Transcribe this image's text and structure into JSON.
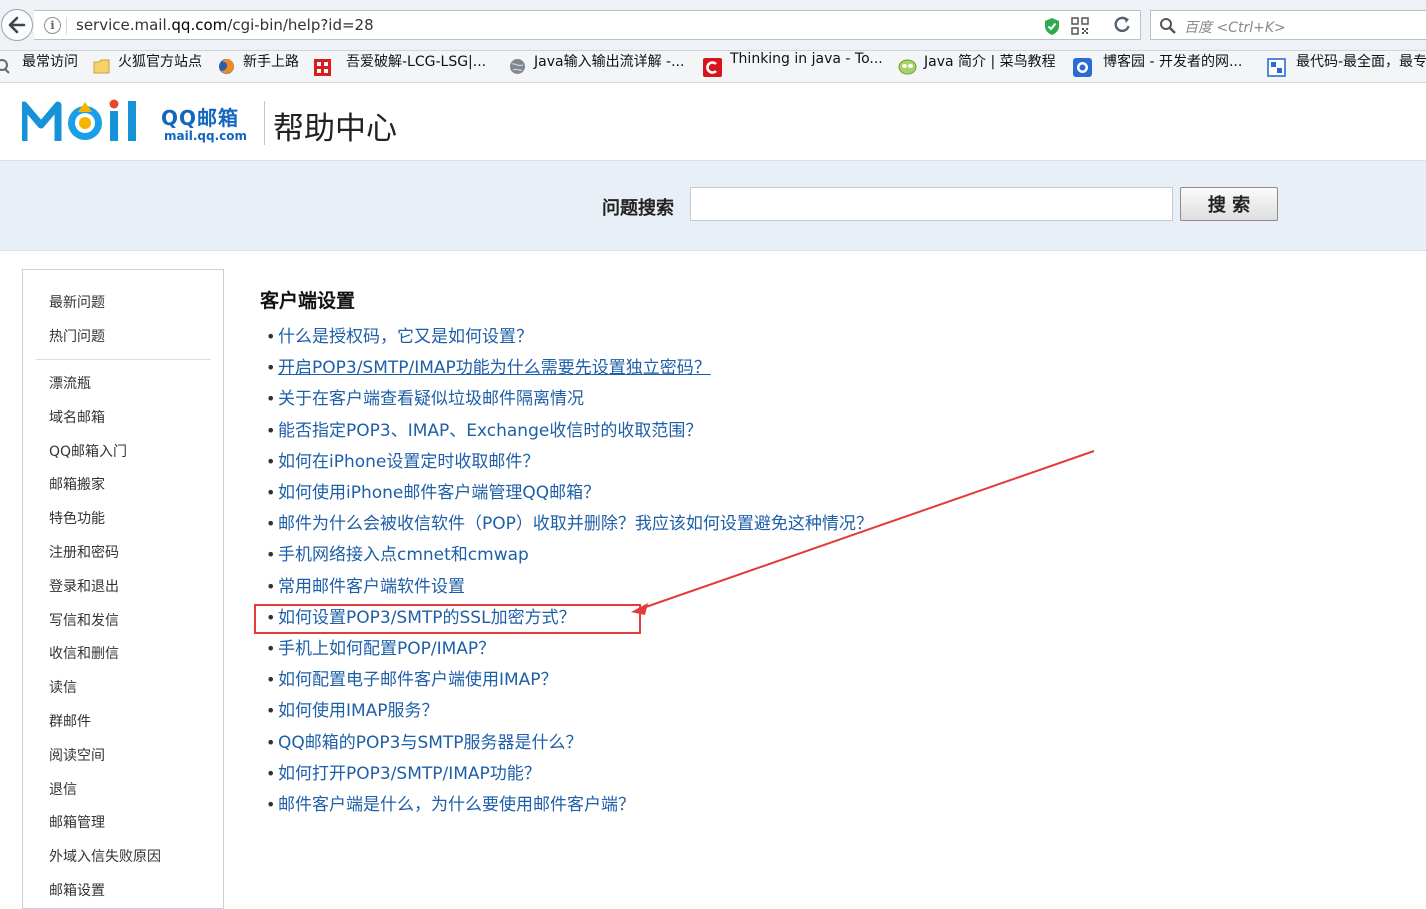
{
  "browser": {
    "url_prefix": "service.mail.",
    "url_host": "qq.com",
    "url_path": "/cgi-bin/help?id=28",
    "search_placeholder": "百度 <Ctrl+K>",
    "bookmarks": [
      {
        "label": "最常访问",
        "icon": "most-visited-icon"
      },
      {
        "label": "火狐官方站点",
        "icon": "folder-icon"
      },
      {
        "label": "新手上路",
        "icon": "firefox-icon"
      },
      {
        "label": "吾爱破解-LCG-LSG|...",
        "icon": "site-icon"
      },
      {
        "label": "Java输入输出流详解 -...",
        "icon": "globe-icon"
      },
      {
        "label": "Thinking in java - To...",
        "icon": "csdn-icon"
      },
      {
        "label": "Java 简介 | 菜鸟教程",
        "icon": "runoob-icon"
      },
      {
        "label": "博客园 - 开发者的网...",
        "icon": "cnblogs-icon"
      },
      {
        "label": "最代码-最全面，最专",
        "icon": "zuidaima-icon"
      }
    ]
  },
  "header": {
    "logo_text": "QQ邮箱",
    "logo_domain": "mail.qq.com",
    "title": "帮助中心"
  },
  "search": {
    "label": "问题搜索",
    "placeholder": "",
    "button": "搜 索"
  },
  "sidebar": {
    "top_items": [
      "最新问题",
      "热门问题"
    ],
    "items": [
      "漂流瓶",
      "域名邮箱",
      "QQ邮箱入门",
      "邮箱搬家",
      "特色功能",
      "注册和密码",
      "登录和退出",
      "写信和发信",
      "收信和删信",
      "读信",
      "群邮件",
      "阅读空间",
      "退信",
      "邮箱管理",
      "外域入信失败原因",
      "邮箱设置"
    ]
  },
  "main": {
    "section_title": "客户端设置",
    "bullet": "•",
    "questions": [
      "什么是授权码，它又是如何设置？",
      "开启POP3/SMTP/IMAP功能为什么需要先设置独立密码？",
      "关于在客户端查看疑似垃圾邮件隔离情况",
      "能否指定POP3、IMAP、Exchange收信时的收取范围？",
      "如何在iPhone设置定时收取邮件？",
      "如何使用iPhone邮件客户端管理QQ邮箱？",
      "邮件为什么会被收信软件（POP）收取并删除？我应该如何设置避免这种情况？",
      "手机网络接入点cmnet和cmwap",
      "常用邮件客户端软件设置",
      "如何设置POP3/SMTP的SSL加密方式？",
      "手机上如何配置POP/IMAP？",
      "如何配置电子邮件客户端使用IMAP？",
      "如何使用IMAP服务？",
      "QQ邮箱的POP3与SMTP服务器是什么？",
      "如何打开POP3/SMTP/IMAP功能？",
      "邮件客户端是什么，为什么要使用邮件客户端？"
    ],
    "hovered_index": 1,
    "highlighted_index": 9,
    "annotation_color": "#e33b3b"
  }
}
